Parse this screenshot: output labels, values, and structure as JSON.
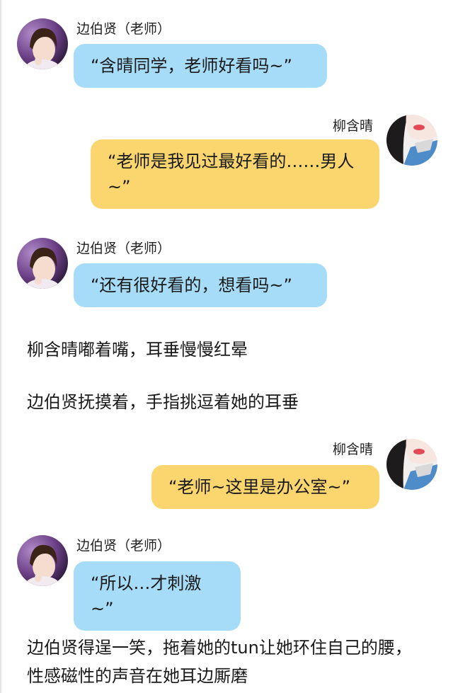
{
  "chat": {
    "teacher_name": "边伯贤（老师）",
    "student_name": "柳含晴",
    "msg1": "“含晴同学，老师好看吗~”",
    "msg2": "“老师是我见过最好看的……男人~”",
    "msg3": "“还有很好看的，想看吗~”",
    "narration1": "柳含晴嘟着嘴，耳垂慢慢红晕",
    "narration2": "边伯贤抚摸着，手指挑逗着她的耳垂",
    "msg4": "“老师~这里是办公室~”",
    "msg5": "“所以…才刺激~”",
    "narration3": "边伯贤得逞一笑，拖着她的tun让她环住自己的腰，性感磁性的声音在她耳边厮磨"
  },
  "colors": {
    "left_bubble": "#a6dcf8",
    "right_bubble": "#fbd56e"
  }
}
